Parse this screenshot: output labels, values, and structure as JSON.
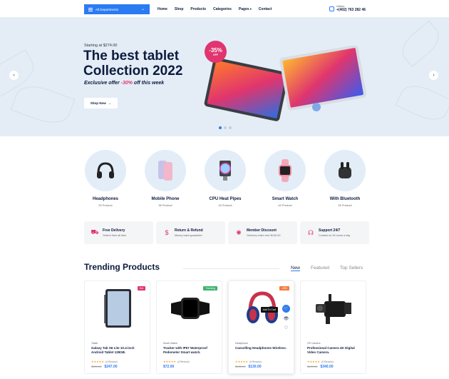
{
  "header": {
    "departments_label": "All Departments",
    "nav": [
      "Home",
      "Shop",
      "Products",
      "Categories",
      "Pages",
      "Contact"
    ],
    "hotline_label": "Hotline:",
    "hotline_number": "+(402) 763 282 46"
  },
  "hero": {
    "starting": "Starting at $274.00",
    "title_line1": "The best tablet",
    "title_line2": "Collection 2022",
    "offer_prefix": "Exclusive offer ",
    "offer_pct": "-30%",
    "offer_suffix": " off this week",
    "shop_label": "Shop Now",
    "discount": "-35%",
    "discount_sub": "OFF"
  },
  "categories": [
    {
      "name": "Headphones",
      "count": "20 Product"
    },
    {
      "name": "Mobile Phone",
      "count": "36 Product"
    },
    {
      "name": "CPU Heat Pipes",
      "count": "16 Product"
    },
    {
      "name": "Smart Watch",
      "count": "44 Product"
    },
    {
      "name": "With Bluetooth",
      "count": "26 Product"
    }
  ],
  "features": [
    {
      "title": "Free Delivery",
      "sub": "Orders from all item"
    },
    {
      "title": "Return & Refund",
      "sub": "Money back guarantee"
    },
    {
      "title": "Member Discount",
      "sub": "Onevery order over $140.00"
    },
    {
      "title": "Support 24/7",
      "sub": "Contact us 24 hours a day"
    }
  ],
  "trending": {
    "title": "Trending Products",
    "tabs": [
      "New",
      "Featured",
      "Top Sellers"
    ]
  },
  "products": [
    {
      "category": "Tablet",
      "title": "Galaxy Tab S6 Lite 10.4-inch Android Tablet 128GB.",
      "reviews": "(4 Review)",
      "old_price": "$320.00",
      "price": "$247.00",
      "tag": "Hot",
      "tag_color": "#e0356e"
    },
    {
      "category": "Smart Watch",
      "title": "Tracker with IP67 Waterproof Pedometer Smart watch.",
      "reviews": "(4 Review)",
      "old_price": "",
      "price": "$72.00",
      "tag": "Trending",
      "tag_color": "#3bb36a"
    },
    {
      "category": "Headphone",
      "title": "Cancelling Headphones Wireless.",
      "reviews": "(3 Review)",
      "old_price": "$155.00",
      "price": "$130.00",
      "tag": "-15%",
      "tag_color": "#f47c3c",
      "add_to_cart": "Add To Cart"
    },
    {
      "category": "CR Camera",
      "title": "Professional Camera 4K Digital Video Camera.",
      "reviews": "(3 Review)",
      "old_price": "$420.00",
      "price": "$340.00",
      "tag": "",
      "tag_color": ""
    }
  ]
}
